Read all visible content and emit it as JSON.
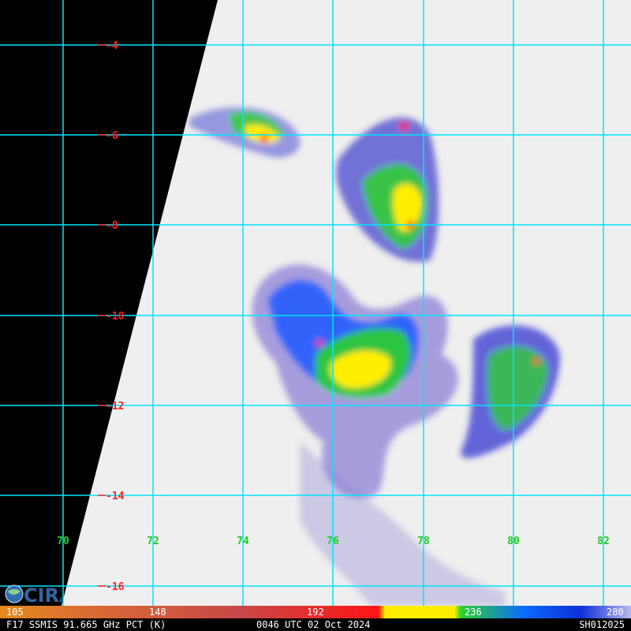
{
  "map": {
    "lat_labels": [
      "-4",
      "-6",
      "-8",
      "-10",
      "-12",
      "-14",
      "-16"
    ],
    "lon_labels": [
      "70",
      "72",
      "74",
      "76",
      "78",
      "80",
      "82"
    ],
    "grid_color": "#00e5ff",
    "background_color": "#efefef",
    "no_data_color": "#000000"
  },
  "logo": {
    "text": "CIRA"
  },
  "colorbar": {
    "ticks": [
      "105",
      "148",
      "192",
      "236",
      "280"
    ],
    "segments": [
      {
        "color": "#e48a1c"
      },
      {
        "color": "#d86a2c"
      },
      {
        "color": "#cc3b3b"
      },
      {
        "color": "#ff1515"
      },
      {
        "color": "#ffee00"
      },
      {
        "color": "#2dd12d"
      },
      {
        "color": "#0d6bff"
      },
      {
        "color": "#0d2fd9"
      },
      {
        "color": "#b8b8ee"
      }
    ]
  },
  "footer": {
    "left": "F17 SSMIS 91.665 GHz PCT (K)",
    "center": "0046 UTC 02 Oct 2024",
    "right": "SH012025"
  }
}
